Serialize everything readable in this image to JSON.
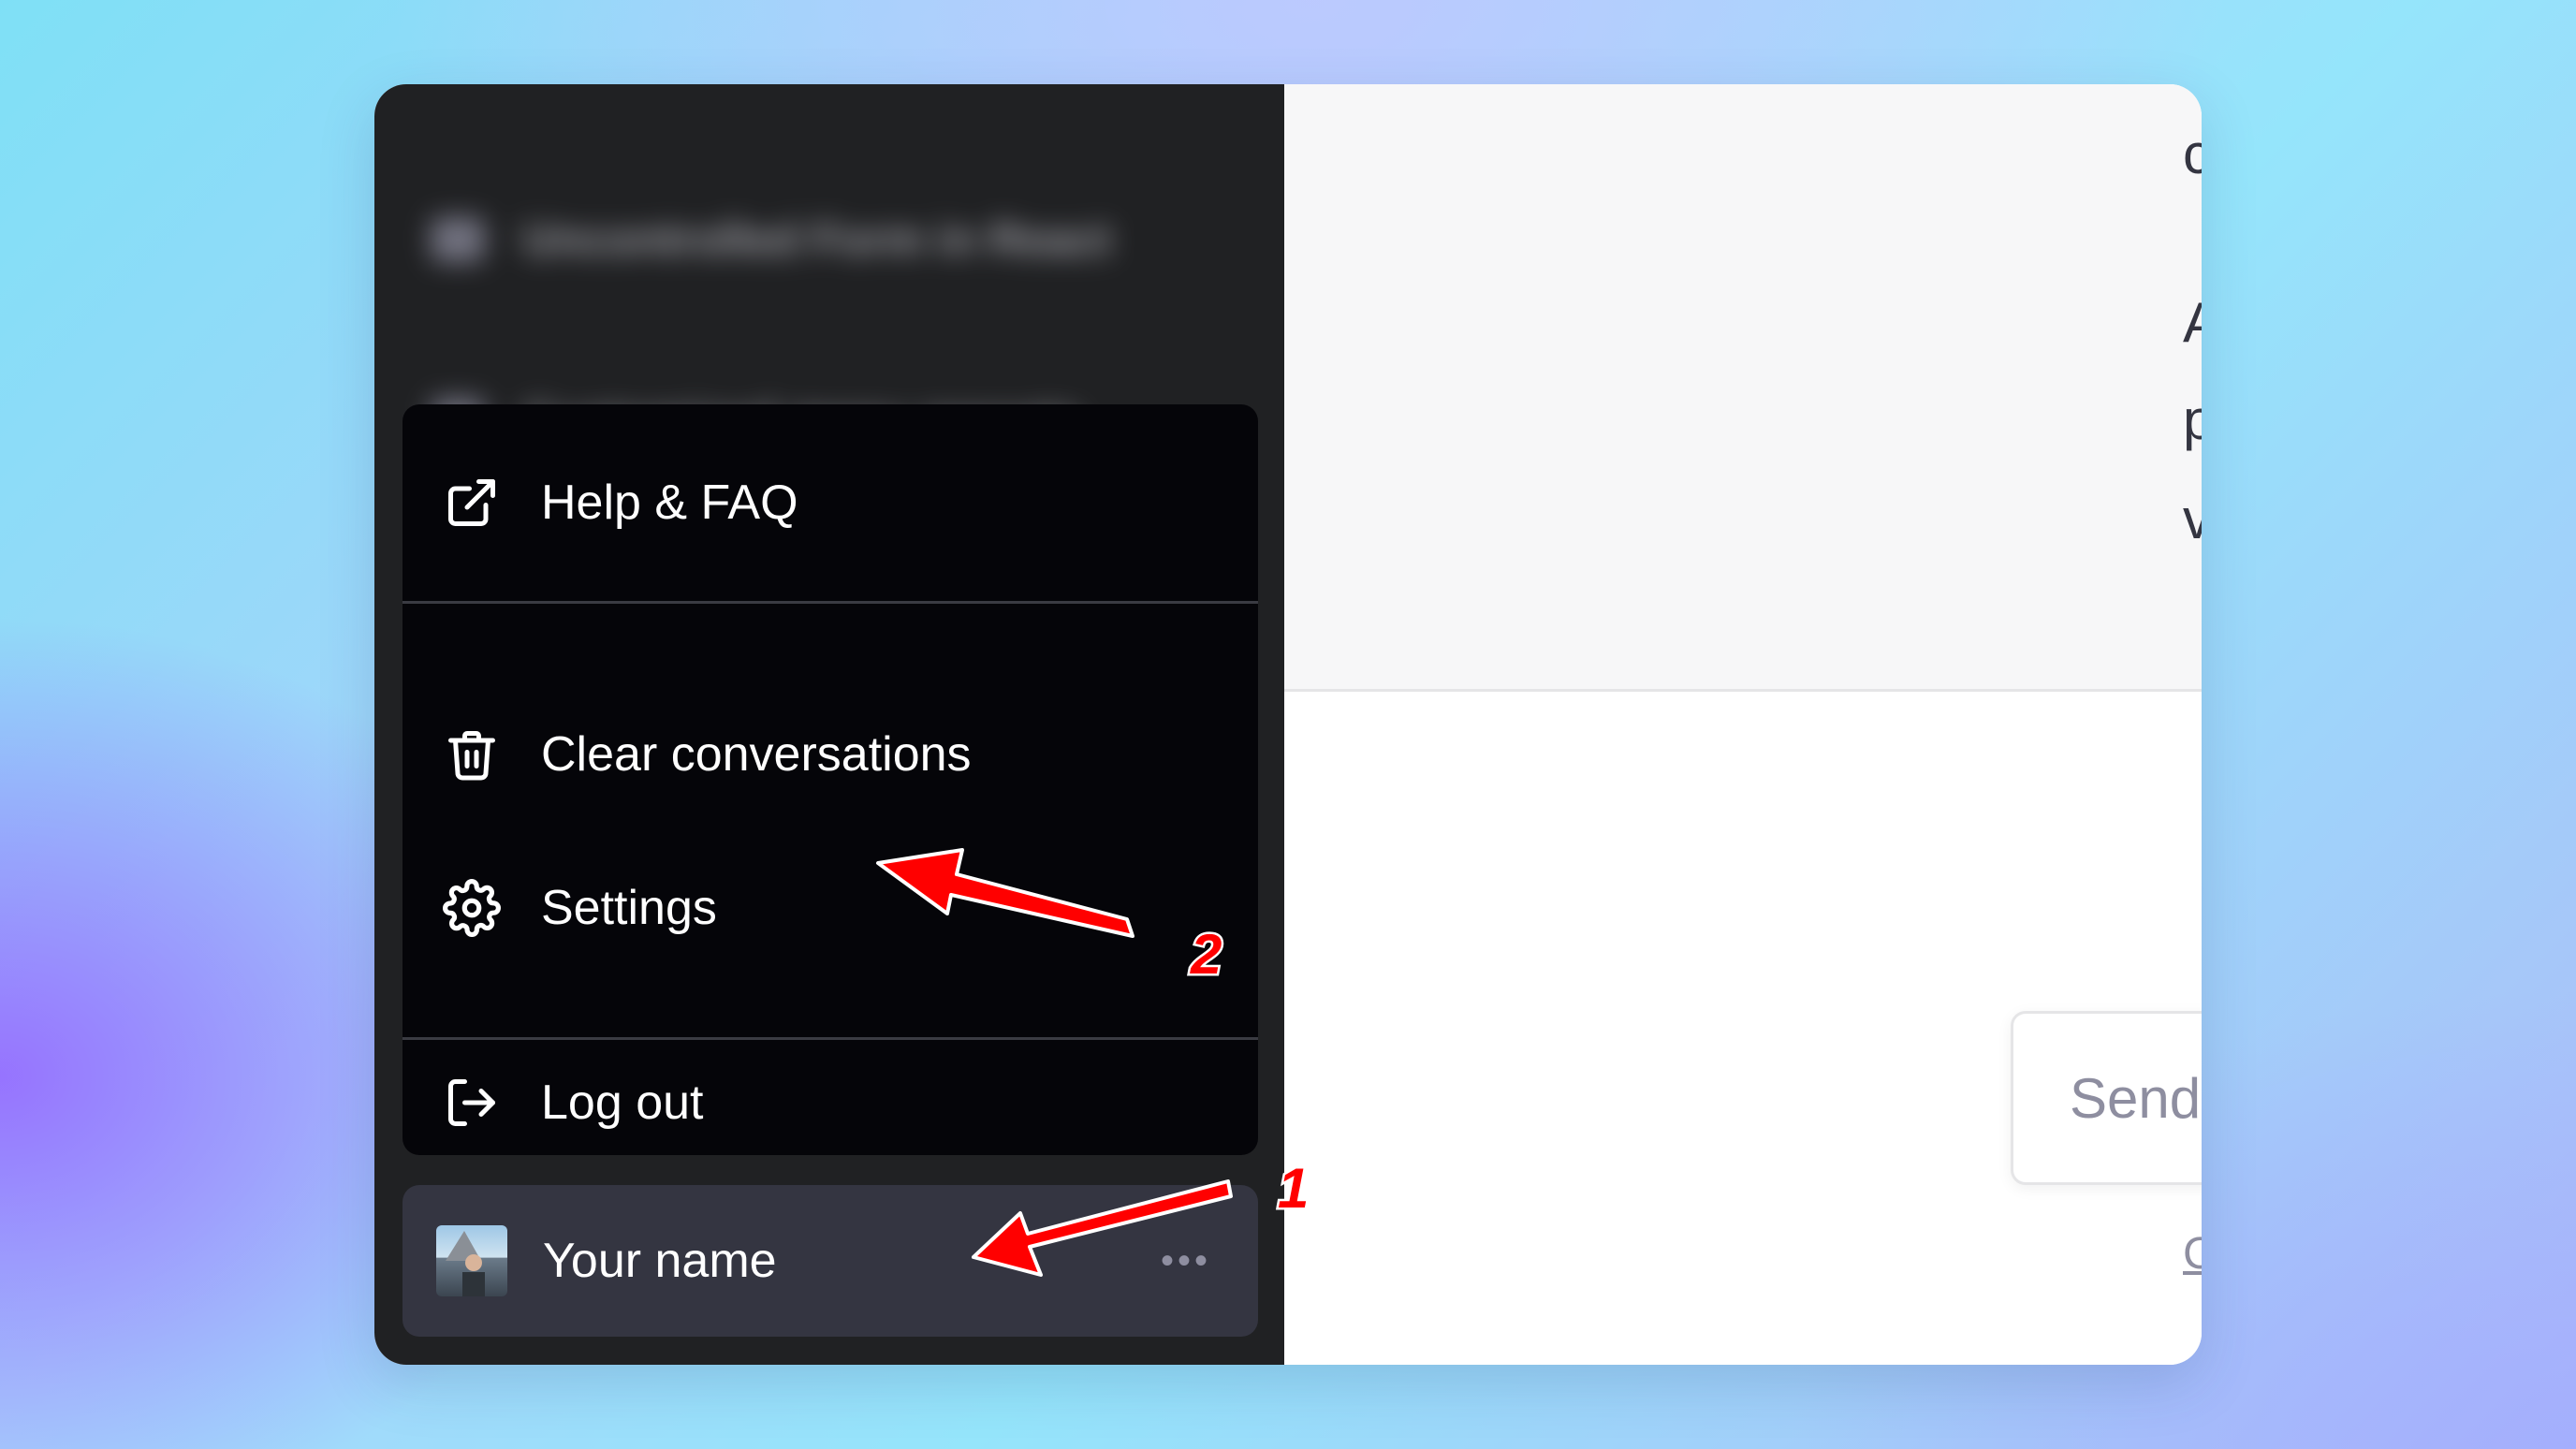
{
  "sidebar": {
    "history": [
      {
        "label": "Uncontrolled Form in React"
      },
      {
        "label": "Customized menu presets"
      }
    ],
    "menu": {
      "help": "Help & FAQ",
      "clear": "Clear conversations",
      "settings": "Settings",
      "logout": "Log out"
    },
    "user": {
      "name": "Your name",
      "more": "•••"
    }
  },
  "main": {
    "partial_lines": [
      "c",
      "A",
      "p",
      "v"
    ],
    "send_placeholder": "Send",
    "partial_link": "C"
  },
  "annotations": {
    "step1": "1",
    "step2": "2",
    "color": "#ff0000"
  }
}
